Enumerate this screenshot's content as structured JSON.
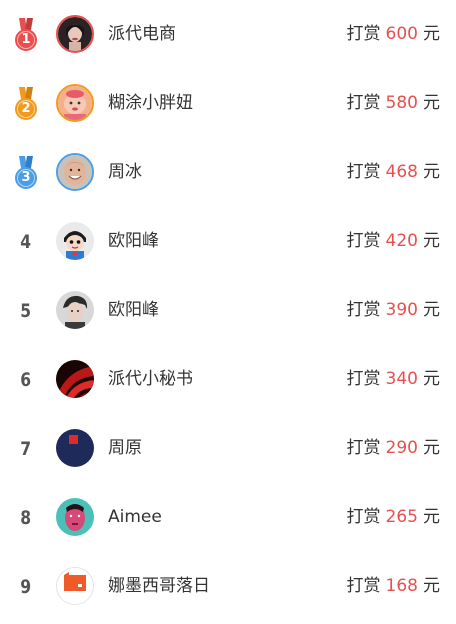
{
  "reward_label": "打赏",
  "unit_label": "元",
  "accent_color": "#e8504f",
  "medal_colors": [
    "#e8504f",
    "#f39a1c",
    "#4a9de6"
  ],
  "rows": [
    {
      "rank": "1",
      "name": "派代电商",
      "amount": "600",
      "avatar_icon": "woman-portrait-icon",
      "medal": "gold-medal-icon"
    },
    {
      "rank": "2",
      "name": "糊涂小胖妞",
      "amount": "580",
      "avatar_icon": "baby-portrait-icon",
      "medal": "silver-medal-icon"
    },
    {
      "rank": "3",
      "name": "周冰",
      "amount": "468",
      "avatar_icon": "smiling-man-icon",
      "medal": "bronze-medal-icon"
    },
    {
      "rank": "4",
      "name": "欧阳峰",
      "amount": "420",
      "avatar_icon": "cartoon-avatar-icon"
    },
    {
      "rank": "5",
      "name": "欧阳峰",
      "amount": "390",
      "avatar_icon": "man-portrait-icon"
    },
    {
      "rank": "6",
      "name": "派代小秘书",
      "amount": "340",
      "avatar_icon": "red-abstract-icon"
    },
    {
      "rank": "7",
      "name": "周原",
      "amount": "290",
      "avatar_icon": "navy-square-icon"
    },
    {
      "rank": "8",
      "name": "Aimee",
      "amount": "265",
      "avatar_icon": "pink-portrait-icon"
    },
    {
      "rank": "9",
      "name": "娜墨西哥落日",
      "amount": "168",
      "avatar_icon": "orange-logo-icon"
    }
  ]
}
